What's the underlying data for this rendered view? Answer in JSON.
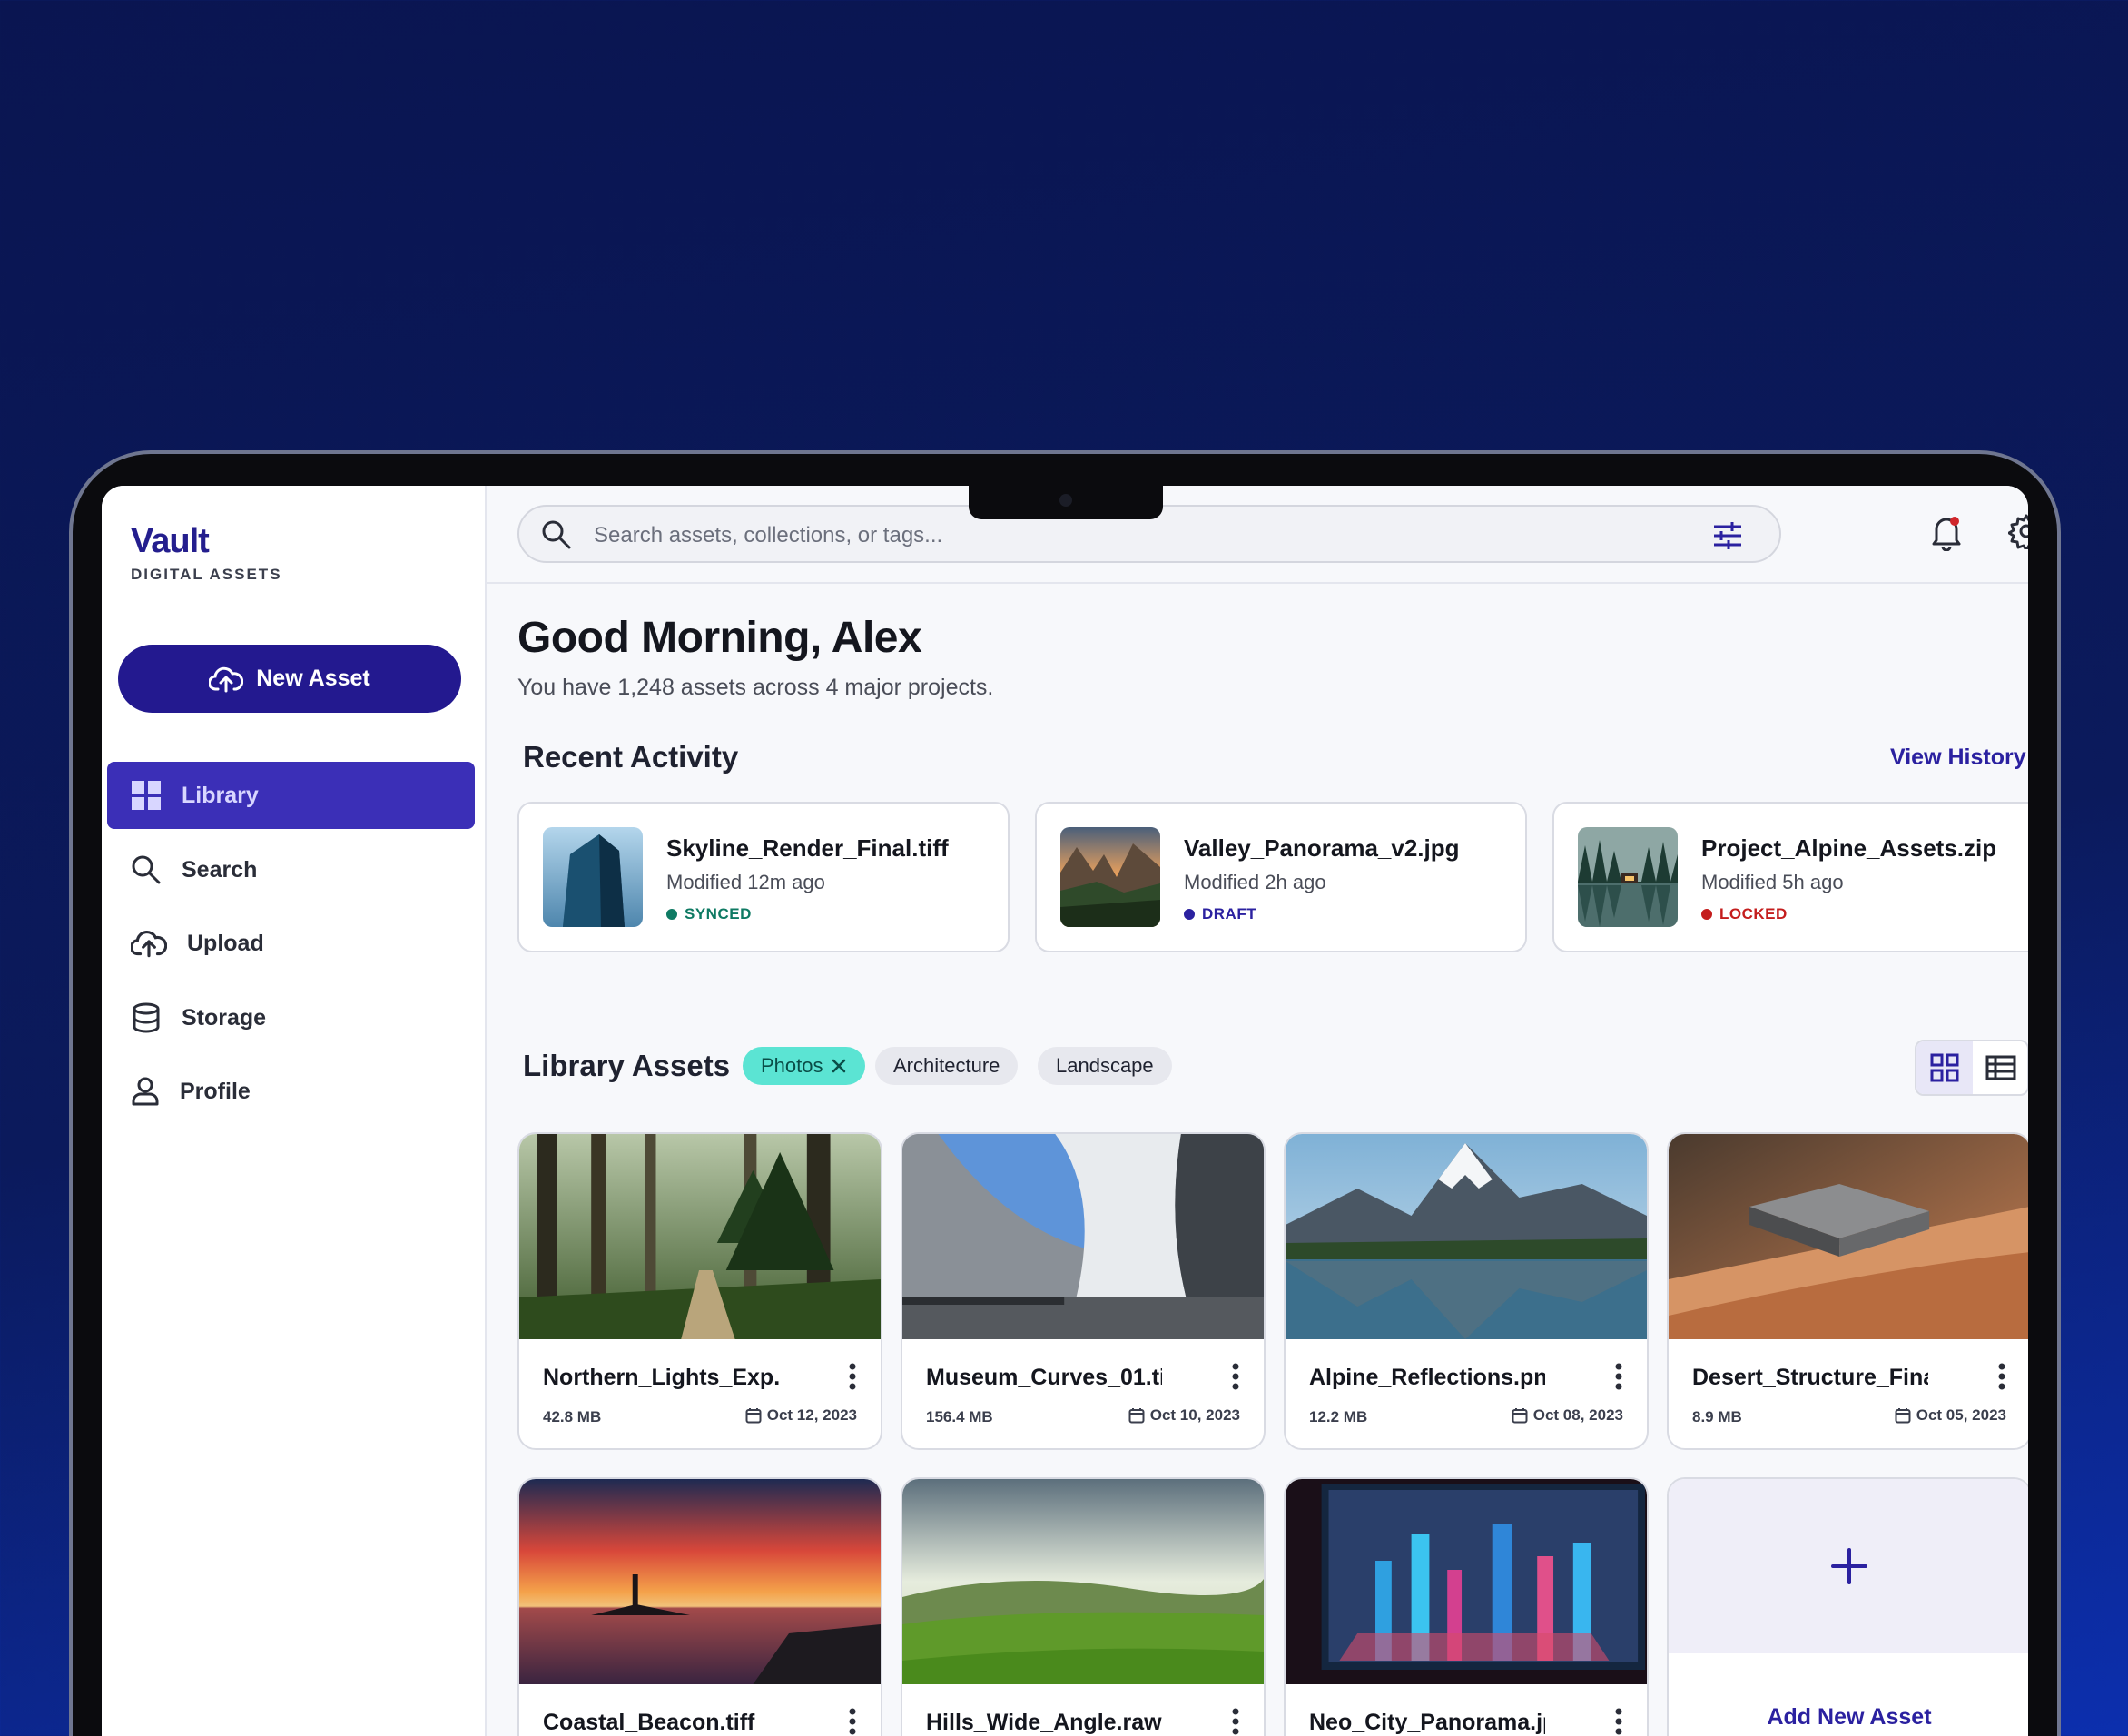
{
  "app": {
    "name": "Vault",
    "subtitle": "DIGITAL ASSETS"
  },
  "sidebar": {
    "new_asset_label": "New Asset",
    "items": [
      {
        "label": "Library",
        "icon": "grid-icon",
        "active": true
      },
      {
        "label": "Search",
        "icon": "search-icon"
      },
      {
        "label": "Upload",
        "icon": "cloud-upload-icon"
      },
      {
        "label": "Storage",
        "icon": "database-icon"
      },
      {
        "label": "Profile",
        "icon": "user-icon"
      }
    ]
  },
  "topbar": {
    "search_placeholder": "Search assets, collections, or tags...",
    "icons": [
      "filter-icon",
      "bell-icon",
      "gear-icon",
      "avatar"
    ]
  },
  "header": {
    "greeting": "Good Morning, Alex",
    "subtitle": "You have 1,248 assets across 4 major projects."
  },
  "recent": {
    "title": "Recent Activity",
    "view_history": "View History",
    "items": [
      {
        "name": "Skyline_Render_Final.tiff",
        "modified": "Modified 12m ago",
        "status": "SYNCED",
        "status_color": "#0e7a63"
      },
      {
        "name": "Valley_Panorama_v2.jpg",
        "modified": "Modified 2h ago",
        "status": "DRAFT",
        "status_color": "#2b21a0"
      },
      {
        "name": "Project_Alpine_Assets.zip",
        "modified": "Modified 5h ago",
        "status": "LOCKED",
        "status_color": "#c41d1d"
      }
    ]
  },
  "library": {
    "title": "Library Assets",
    "filters": [
      {
        "label": "Photos",
        "active": true
      },
      {
        "label": "Architecture"
      },
      {
        "label": "Landscape"
      }
    ],
    "assets": [
      {
        "name": "Northern_Lights_Exp.",
        "size": "42.8 MB",
        "date": "Oct 12, 2023"
      },
      {
        "name": "Museum_Curves_01.ti",
        "size": "156.4 MB",
        "date": "Oct 10, 2023"
      },
      {
        "name": "Alpine_Reflections.pn",
        "size": "12.2 MB",
        "date": "Oct 08, 2023"
      },
      {
        "name": "Desert_Structure_Fina",
        "size": "8.9 MB",
        "date": "Oct 05, 2023"
      },
      {
        "name": "Coastal_Beacon.tiff"
      },
      {
        "name": "Hills_Wide_Angle.raw"
      },
      {
        "name": "Neo_City_Panorama.jp"
      }
    ],
    "add_label": "Add New Asset"
  },
  "colors": {
    "accent": "#23198f",
    "active_nav": "#3b2fb7",
    "chip_active": "#5be4d3",
    "background": "#0a1551"
  }
}
